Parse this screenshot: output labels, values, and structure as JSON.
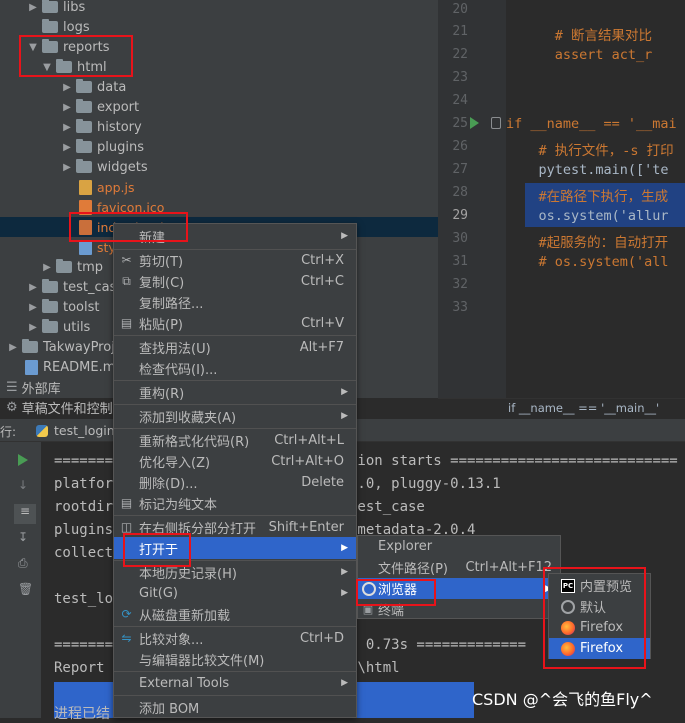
{
  "project_tree": {
    "items": [
      "libs",
      "logs",
      "reports",
      "html",
      "data",
      "export",
      "history",
      "plugins",
      "widgets",
      "app.js",
      "favicon.ico",
      "index.html",
      "sty",
      "tmp",
      "test_case",
      "toolst",
      "utils",
      "TakwayProje",
      "README.md",
      "外部库",
      "草稿文件和控制台"
    ]
  },
  "editor": {
    "line_numbers": [
      "20",
      "21",
      "22",
      "23",
      "24",
      "25",
      "26",
      "27",
      "28",
      "29",
      "30",
      "31",
      "32",
      "33"
    ],
    "lines": [
      "",
      "      # 断言结果对比",
      "      assert act_r",
      "",
      "",
      "if __name__ == '__mai",
      "    # 执行文件，-s 打印",
      "    pytest.main(['te",
      "    #在路径下执行，生成",
      "    os.system('allur",
      "    #起服务的：自动打开",
      "    # os.system('all",
      "",
      ""
    ],
    "breadcrumb": "if __name__ == '__main__'"
  },
  "run_panel": {
    "prefix": "行:",
    "tab": "test_login"
  },
  "console": {
    "lines": [
      "========================== test session starts ===========================",
      "platfor                    ytest-7.2.0, pluggy-0.13.1",
      "rootdir                    utotest\\test_case",
      "plugins                    l-3.2.0, metadata-2.0.4",
      "collect",
      "",
      "test_lo",
      "",
      "==========                 passed in 0.73s =============",
      "Report                     .\\reports\\html",
      "",
      "进程已结"
    ]
  },
  "context_menu": {
    "items": [
      {
        "label": "新建",
        "shortcut": "",
        "submenu": true,
        "icon": ""
      },
      {
        "label": "剪切(T)",
        "shortcut": "Ctrl+X",
        "submenu": false,
        "icon": "scissors-icon"
      },
      {
        "label": "复制(C)",
        "shortcut": "Ctrl+C",
        "submenu": false,
        "icon": "copy-icon"
      },
      {
        "label": "复制路径...",
        "shortcut": "",
        "submenu": false,
        "icon": ""
      },
      {
        "label": "粘贴(P)",
        "shortcut": "Ctrl+V",
        "submenu": false,
        "icon": "paste-icon"
      },
      {
        "label": "查找用法(U)",
        "shortcut": "Alt+F7",
        "submenu": false,
        "icon": ""
      },
      {
        "label": "检查代码(I)...",
        "shortcut": "",
        "submenu": false,
        "icon": ""
      },
      {
        "label": "重构(R)",
        "shortcut": "",
        "submenu": true,
        "icon": ""
      },
      {
        "label": "添加到收藏夹(A)",
        "shortcut": "",
        "submenu": true,
        "icon": ""
      },
      {
        "label": "重新格式化代码(R)",
        "shortcut": "Ctrl+Alt+L",
        "submenu": false,
        "icon": ""
      },
      {
        "label": "优化导入(Z)",
        "shortcut": "Ctrl+Alt+O",
        "submenu": false,
        "icon": ""
      },
      {
        "label": "删除(D)...",
        "shortcut": "Delete",
        "submenu": false,
        "icon": ""
      },
      {
        "label": "标记为纯文本",
        "shortcut": "",
        "submenu": false,
        "icon": "text-icon"
      },
      {
        "label": "在右侧拆分部分打开",
        "shortcut": "Shift+Enter",
        "submenu": false,
        "icon": "split-icon"
      },
      {
        "label": "打开于",
        "shortcut": "",
        "submenu": true,
        "icon": ""
      },
      {
        "label": "本地历史记录(H)",
        "shortcut": "",
        "submenu": true,
        "icon": ""
      },
      {
        "label": "Git(G)",
        "shortcut": "",
        "submenu": true,
        "icon": ""
      },
      {
        "label": "从磁盘重新加载",
        "shortcut": "",
        "submenu": false,
        "icon": "reload-icon"
      },
      {
        "label": "比较对象...",
        "shortcut": "Ctrl+D",
        "submenu": false,
        "icon": "compare-icon"
      },
      {
        "label": "与编辑器比较文件(M)",
        "shortcut": "",
        "submenu": false,
        "icon": ""
      },
      {
        "label": "External Tools",
        "shortcut": "",
        "submenu": true,
        "icon": ""
      },
      {
        "label": "添加 BOM",
        "shortcut": "",
        "submenu": false,
        "icon": ""
      }
    ]
  },
  "open_in_submenu": {
    "items": [
      {
        "label": "Explorer",
        "shortcut": ""
      },
      {
        "label": "文件路径(P)",
        "shortcut": "Ctrl+Alt+F12"
      },
      {
        "label": "浏览器",
        "shortcut": ""
      },
      {
        "label": "终端",
        "shortcut": ""
      }
    ]
  },
  "browser_submenu": {
    "items": [
      {
        "label": "内置预览",
        "icon": "pycharm-icon"
      },
      {
        "label": "默认",
        "icon": "globe-icon"
      },
      {
        "label": "Firefox",
        "icon": "firefox-icon"
      },
      {
        "label": "Firefox",
        "icon": "firefox-icon"
      }
    ]
  },
  "watermark": "CSDN @^会飞的鱼Fly^",
  "colors": {
    "selection": "#2f65ca",
    "annotation": "#e8131a",
    "background": "#2b2b2b",
    "panel": "#3c3f41"
  }
}
